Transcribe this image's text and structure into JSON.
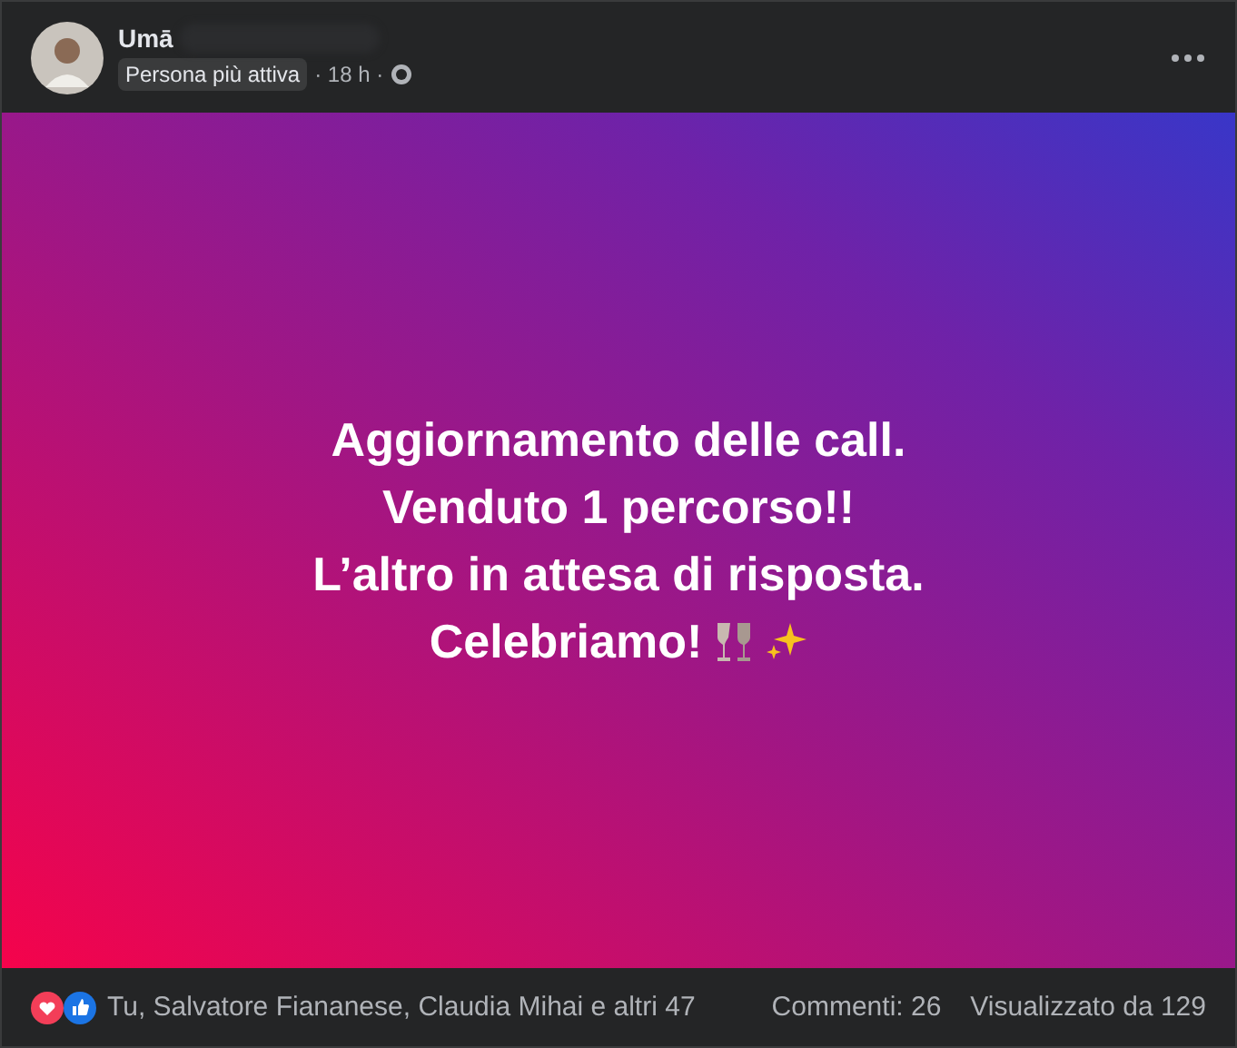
{
  "author": {
    "name": "Umā",
    "badge": "Persona più attiva",
    "time": "· 18 h ·"
  },
  "post": {
    "lines": [
      "Aggiornamento delle call.",
      "Venduto 1 percorso!!",
      "L’altro in attesa di risposta.",
      "Celebriamo!"
    ]
  },
  "footer": {
    "reactions": "Tu, Salvatore Fiananese, Claudia Mihai e altri 47",
    "comments": "Commenti: 26",
    "views": "Visualizzato da 129"
  }
}
